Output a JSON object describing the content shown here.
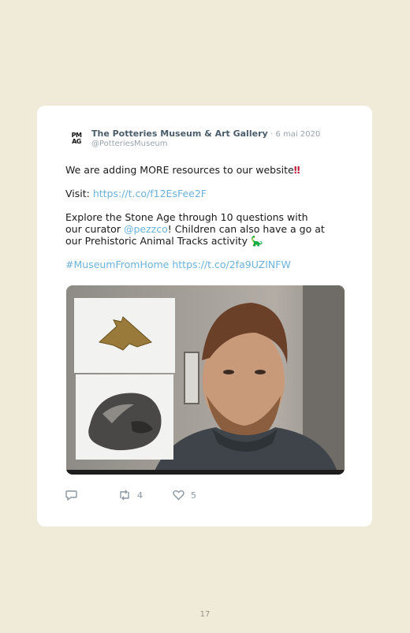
{
  "tweet": {
    "author_name": "The Potteries Museum & Art Gallery",
    "date": "· 6 mai 2020",
    "handle": "@PotteriesMuseum",
    "avatar_top": "PM",
    "avatar_bottom": "AG",
    "line1": "We are adding MORE resources to our website",
    "line1_emoji": "‼",
    "visit_label": "Visit: ",
    "visit_link": "https://t.co/f12EsFee2F",
    "para3_a": "Explore the Stone Age through 10 questions with our curator ",
    "para3_mention": "@pezzco",
    "para3_b": "! Children can also have a go at our Prehistoric Animal Tracks activity ",
    "para3_emoji": "🦕",
    "hashtag": "#MuseumFromHome",
    "final_link": "https://t.co/2fa9UZINFW"
  },
  "actions": {
    "reply_icon": "reply-icon",
    "retweet_icon": "retweet-icon",
    "retweet_count": "4",
    "like_icon": "heart-icon",
    "like_count": "5"
  },
  "page_number": "17",
  "colors": {
    "background": "#f0ead8",
    "link": "#6cb2db",
    "name": "#4a5d6a",
    "muted": "#9aa5ad"
  }
}
